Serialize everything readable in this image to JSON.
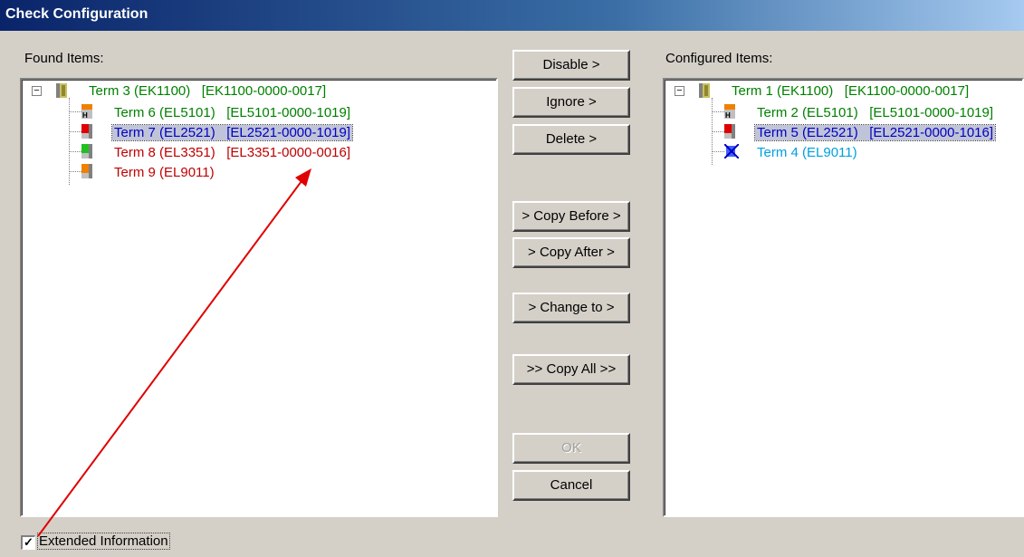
{
  "window": {
    "title": "Check Configuration"
  },
  "found": {
    "label": "Found Items:",
    "items": [
      {
        "name": "Term 3 (EK1100)",
        "id": "[EK1100-0000-0017]"
      },
      {
        "name": "Term 6 (EL5101)",
        "id": "[EL5101-0000-1019]"
      },
      {
        "name": "Term 7 (EL2521)",
        "id": "[EL2521-0000-1019]"
      },
      {
        "name": "Term 8 (EL3351)",
        "id": "[EL3351-0000-0016]"
      },
      {
        "name": "Term 9 (EL9011)",
        "id": ""
      }
    ]
  },
  "configured": {
    "label": "Configured Items:",
    "items": [
      {
        "name": "Term 1 (EK1100)",
        "id": "[EK1100-0000-0017]"
      },
      {
        "name": "Term 2 (EL5101)",
        "id": "[EL5101-0000-1019]"
      },
      {
        "name": "Term 5 (EL2521)",
        "id": "[EL2521-0000-1016]"
      },
      {
        "name": "Term 4 (EL9011)",
        "id": ""
      }
    ]
  },
  "buttons": {
    "disable": "Disable >",
    "ignore": "Ignore >",
    "delete": "Delete >",
    "copy_before": "> Copy Before >",
    "copy_after": "> Copy After >",
    "change_to": "> Change to >",
    "copy_all": ">> Copy All >>",
    "ok": "OK",
    "cancel": "Cancel"
  },
  "extended": {
    "label": "Extended Information",
    "checked": true,
    "mark": "✓"
  },
  "colors": {
    "match": "#008000",
    "mismatch": "#c00000",
    "selected": "#0000c0",
    "missing": "#00a0e0",
    "annotation_arrow": "#e00000"
  }
}
